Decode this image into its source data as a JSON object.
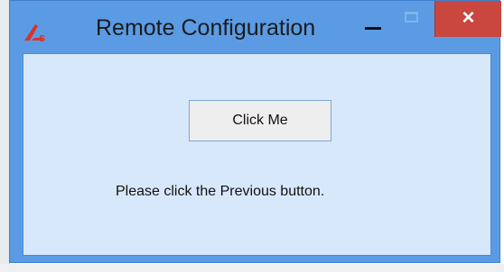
{
  "window": {
    "title": "Remote Configuration",
    "close_glyph": "×",
    "icon": "app-logo-icon"
  },
  "content": {
    "button_label": "Click Me",
    "message": "Please click the Previous button."
  },
  "colors": {
    "titlebar": "#5b9be4",
    "close_button": "#c9473f",
    "client_background": "#d8e8fb",
    "button_face": "#eeeeef"
  }
}
